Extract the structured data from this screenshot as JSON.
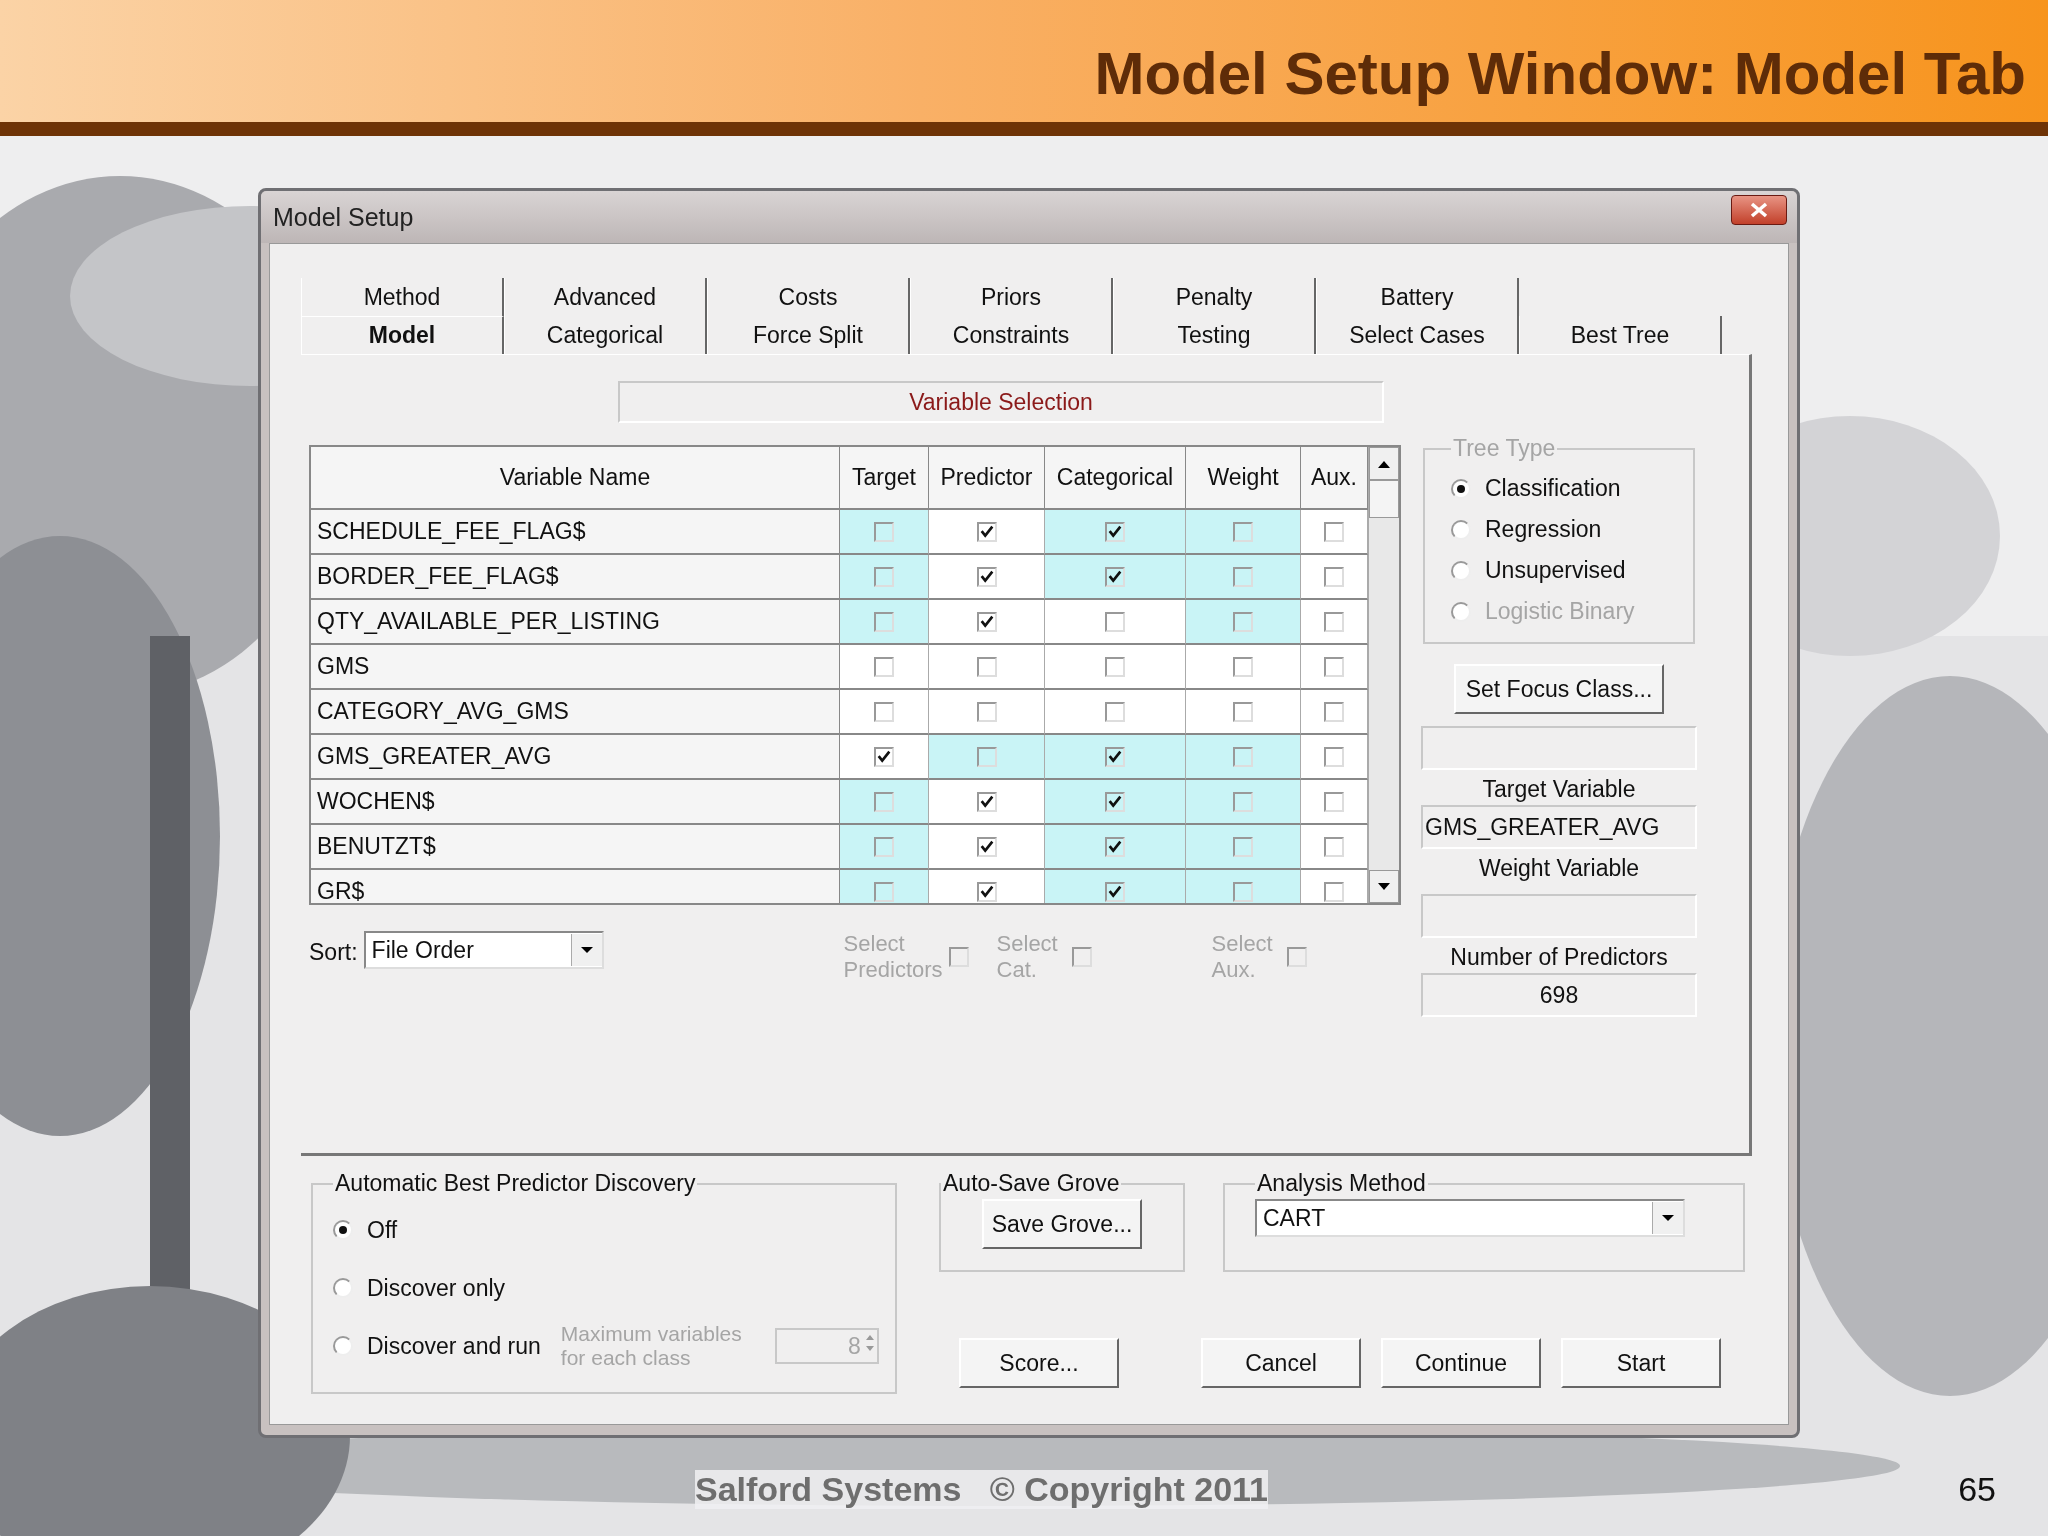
{
  "slide_title": "Model Setup Window: Model Tab",
  "window": {
    "title": "Model Setup"
  },
  "tabs": [
    [
      {
        "label": "Method",
        "selected": false
      },
      {
        "label": "Advanced",
        "selected": false
      },
      {
        "label": "Costs",
        "selected": false
      },
      {
        "label": "Priors",
        "selected": false
      },
      {
        "label": "Penalty",
        "selected": false
      },
      {
        "label": "Battery",
        "selected": false
      }
    ],
    [
      {
        "label": "Model",
        "selected": true
      },
      {
        "label": "Categorical",
        "selected": false
      },
      {
        "label": "Force Split",
        "selected": false
      },
      {
        "label": "Constraints",
        "selected": false
      },
      {
        "label": "Testing",
        "selected": false
      },
      {
        "label": "Select Cases",
        "selected": false
      },
      {
        "label": "Best Tree",
        "selected": false
      }
    ]
  ],
  "section_title": "Variable Selection",
  "table": {
    "columns": [
      "Variable Name",
      "Target",
      "Predictor",
      "Categorical",
      "Weight",
      "Aux."
    ],
    "rows": [
      {
        "name": "SCHEDULE_FEE_FLAG$",
        "cells": [
          {
            "checked": false,
            "highlighted": true
          },
          {
            "checked": true,
            "highlighted": false
          },
          {
            "checked": true,
            "highlighted": true
          },
          {
            "checked": false,
            "highlighted": true
          },
          {
            "checked": false,
            "highlighted": false
          }
        ]
      },
      {
        "name": "BORDER_FEE_FLAG$",
        "cells": [
          {
            "checked": false,
            "highlighted": true
          },
          {
            "checked": true,
            "highlighted": false
          },
          {
            "checked": true,
            "highlighted": true
          },
          {
            "checked": false,
            "highlighted": true
          },
          {
            "checked": false,
            "highlighted": false
          }
        ]
      },
      {
        "name": "QTY_AVAILABLE_PER_LISTING",
        "cells": [
          {
            "checked": false,
            "highlighted": true
          },
          {
            "checked": true,
            "highlighted": false
          },
          {
            "checked": false,
            "highlighted": false
          },
          {
            "checked": false,
            "highlighted": true
          },
          {
            "checked": false,
            "highlighted": false
          }
        ]
      },
      {
        "name": "GMS",
        "cells": [
          {
            "checked": false,
            "highlighted": false
          },
          {
            "checked": false,
            "highlighted": false
          },
          {
            "checked": false,
            "highlighted": false
          },
          {
            "checked": false,
            "highlighted": false
          },
          {
            "checked": false,
            "highlighted": false
          }
        ]
      },
      {
        "name": "CATEGORY_AVG_GMS",
        "cells": [
          {
            "checked": false,
            "highlighted": false
          },
          {
            "checked": false,
            "highlighted": false
          },
          {
            "checked": false,
            "highlighted": false
          },
          {
            "checked": false,
            "highlighted": false
          },
          {
            "checked": false,
            "highlighted": false
          }
        ]
      },
      {
        "name": "GMS_GREATER_AVG",
        "cells": [
          {
            "checked": true,
            "highlighted": false
          },
          {
            "checked": false,
            "highlighted": true
          },
          {
            "checked": true,
            "highlighted": true
          },
          {
            "checked": false,
            "highlighted": true
          },
          {
            "checked": false,
            "highlighted": false
          }
        ]
      },
      {
        "name": "WOCHEN$",
        "cells": [
          {
            "checked": false,
            "highlighted": true
          },
          {
            "checked": true,
            "highlighted": false
          },
          {
            "checked": true,
            "highlighted": true
          },
          {
            "checked": false,
            "highlighted": true
          },
          {
            "checked": false,
            "highlighted": false
          }
        ]
      },
      {
        "name": "BENUTZT$",
        "cells": [
          {
            "checked": false,
            "highlighted": true
          },
          {
            "checked": true,
            "highlighted": false
          },
          {
            "checked": true,
            "highlighted": true
          },
          {
            "checked": false,
            "highlighted": true
          },
          {
            "checked": false,
            "highlighted": false
          }
        ]
      },
      {
        "name": "GR$",
        "cells": [
          {
            "checked": false,
            "highlighted": true
          },
          {
            "checked": true,
            "highlighted": false
          },
          {
            "checked": true,
            "highlighted": true
          },
          {
            "checked": false,
            "highlighted": true
          },
          {
            "checked": false,
            "highlighted": false
          }
        ]
      }
    ]
  },
  "sort": {
    "label": "Sort:",
    "value": "File Order"
  },
  "select_options": [
    {
      "label": "Select Predictors",
      "checked": false,
      "disabled": true
    },
    {
      "label": "Select Cat.",
      "checked": false,
      "disabled": true
    },
    {
      "label": "Select Aux.",
      "checked": false,
      "disabled": true
    }
  ],
  "tree_type": {
    "title": "Tree Type",
    "disabled": true,
    "options": [
      {
        "label": "Classification",
        "selected": true,
        "disabled": false
      },
      {
        "label": "Regression",
        "selected": false,
        "disabled": false
      },
      {
        "label": "Unsupervised",
        "selected": false,
        "disabled": false
      },
      {
        "label": "Logistic Binary",
        "selected": false,
        "disabled": true
      }
    ]
  },
  "set_focus_button": "Set Focus Class...",
  "target_variable": {
    "label": "Target Variable",
    "value": "GMS_GREATER_AVG"
  },
  "weight_variable": {
    "label": "Weight Variable"
  },
  "number_of_predictors": {
    "label": "Number of Predictors",
    "value": "698"
  },
  "discovery": {
    "title": "Automatic Best Predictor Discovery",
    "options": [
      {
        "label": "Off",
        "selected": true
      },
      {
        "label": "Discover only",
        "selected": false
      },
      {
        "label": "Discover and run",
        "selected": false
      }
    ],
    "max_label": "Maximum variables for each class",
    "max_value": "8"
  },
  "auto_save": {
    "title": "Auto-Save Grove",
    "button": "Save Grove..."
  },
  "analysis_method": {
    "title": "Analysis Method",
    "value": "CART"
  },
  "buttons": [
    "Score...",
    "Cancel",
    "Continue",
    "Start"
  ],
  "footer": {
    "text": "Salford Systems   © Copyright 2011",
    "page": "65"
  }
}
